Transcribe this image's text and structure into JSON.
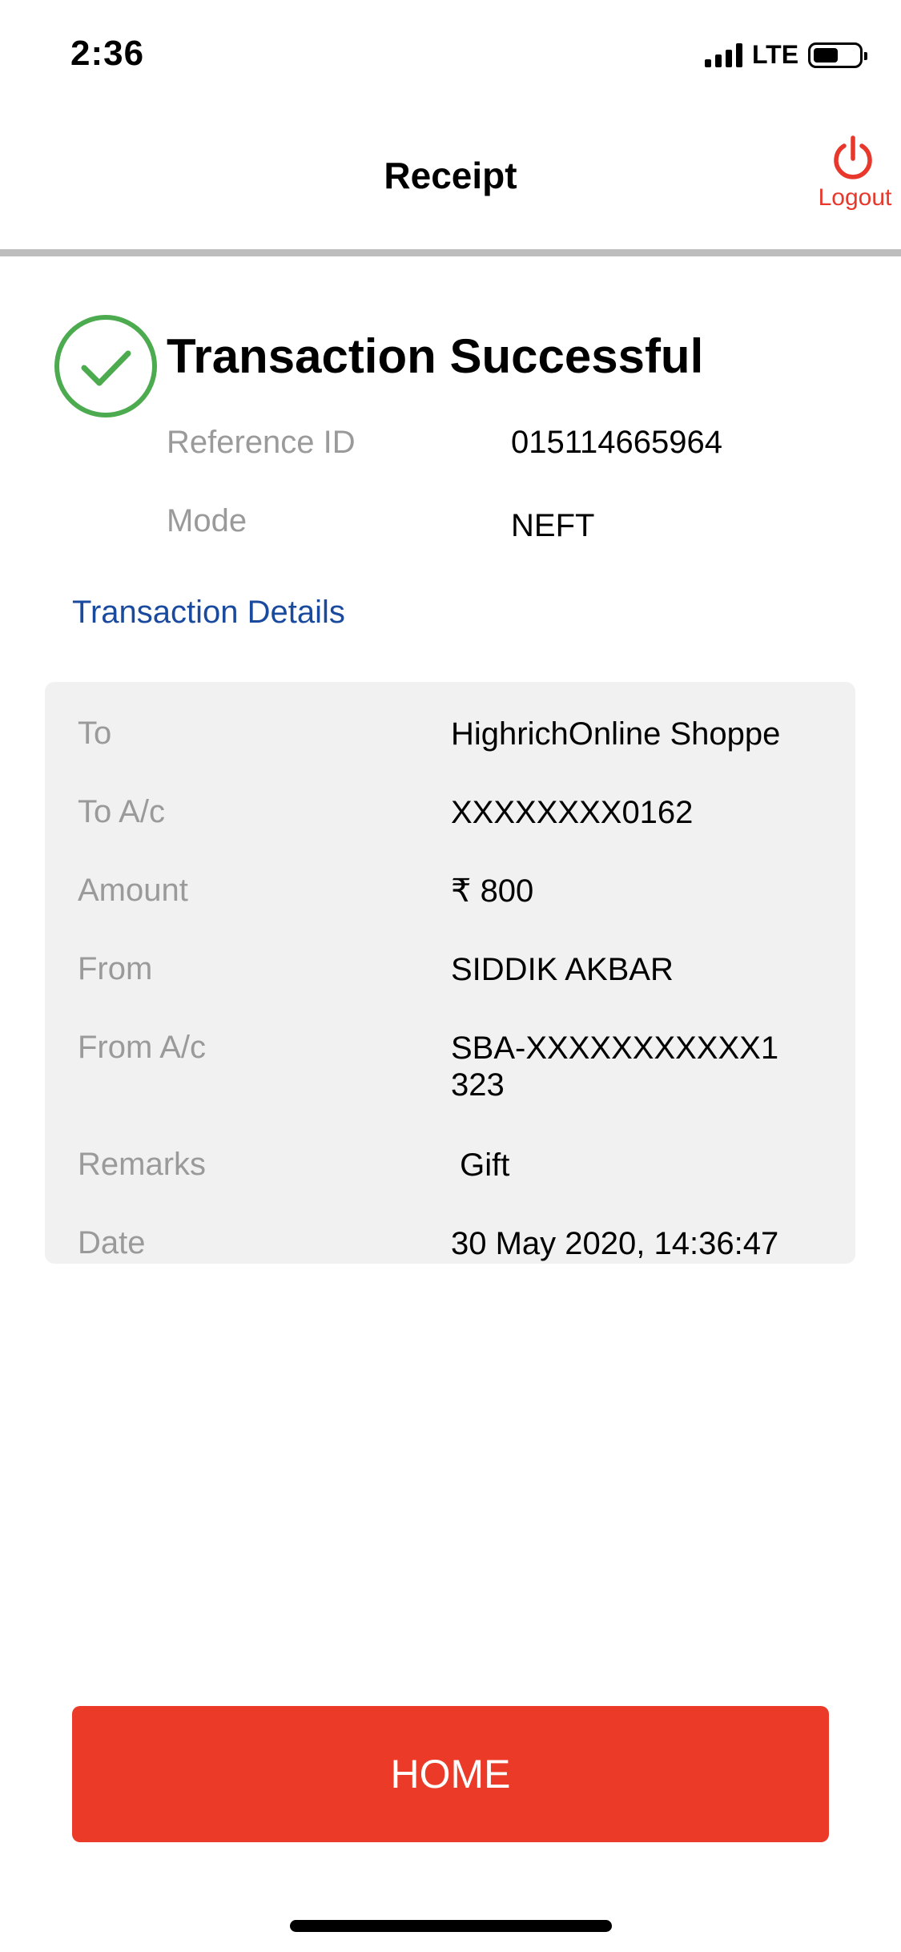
{
  "status_bar": {
    "time": "2:36",
    "network": "LTE",
    "icons": [
      "signal-icon",
      "battery-icon"
    ]
  },
  "header": {
    "title": "Receipt",
    "logout_label": "Logout",
    "logout_icon": "power-icon",
    "accent": "#e8382c"
  },
  "success": {
    "icon": "check-circle-icon",
    "title": "Transaction Successful",
    "reference_label": "Reference ID",
    "reference_value": "015114665964",
    "mode_label": "Mode",
    "mode_value": "NEFT"
  },
  "details_link": "Transaction Details",
  "details": {
    "to_label": "To",
    "to_value": "HighrichOnline Shoppe",
    "to_ac_label": "To A/c",
    "to_ac_value": "XXXXXXXX0162",
    "amount_label": "Amount",
    "amount_value": "₹ 800",
    "from_label": "From",
    "from_value": "SIDDIK AKBAR",
    "from_ac_label": "From A/c",
    "from_ac_value": "SBA-XXXXXXXXXXX1323",
    "remarks_label": "Remarks",
    "remarks_value": " Gift",
    "date_label": "Date",
    "date_value": "30 May 2020, 14:36:47"
  },
  "home_button": "HOME",
  "colors": {
    "primary": "#eb3a27",
    "success": "#4caa4f",
    "link": "#1a4a9e"
  }
}
